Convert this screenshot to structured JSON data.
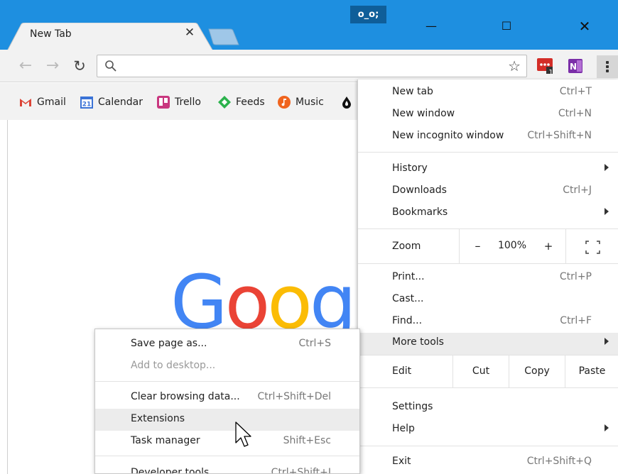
{
  "window": {
    "tab_title": "New Tab",
    "tab_close": "✕",
    "badge": "o_o;",
    "minimize": "—",
    "maximize": "☐",
    "close": "✕"
  },
  "toolbar": {
    "back": "←",
    "forward": "→",
    "reload": "↻",
    "star": "☆",
    "lastpass_count": "1"
  },
  "bookmarks": [
    {
      "label": "Gmail",
      "icon": "gmail-icon"
    },
    {
      "label": "Calendar",
      "icon": "calendar-icon",
      "badge": "21"
    },
    {
      "label": "Trello",
      "icon": "trello-icon"
    },
    {
      "label": "Feeds",
      "icon": "feedly-icon"
    },
    {
      "label": "Music",
      "icon": "music-icon"
    }
  ],
  "google_logo": {
    "letters": [
      "G",
      "o",
      "o",
      "g"
    ],
    "colors": [
      "#4285f4",
      "#ea4335",
      "#fbbc05",
      "#4285f4"
    ]
  },
  "menu": {
    "new_tab": {
      "label": "New tab",
      "shortcut": "Ctrl+T"
    },
    "new_window": {
      "label": "New window",
      "shortcut": "Ctrl+N"
    },
    "new_incognito": {
      "label": "New incognito window",
      "shortcut": "Ctrl+Shift+N"
    },
    "history": {
      "label": "History"
    },
    "downloads": {
      "label": "Downloads",
      "shortcut": "Ctrl+J"
    },
    "bookmarks": {
      "label": "Bookmarks"
    },
    "zoom": {
      "label": "Zoom",
      "minus": "–",
      "value": "100%",
      "plus": "+"
    },
    "print": {
      "label": "Print...",
      "shortcut": "Ctrl+P"
    },
    "cast": {
      "label": "Cast..."
    },
    "find": {
      "label": "Find...",
      "shortcut": "Ctrl+F"
    },
    "more_tools": {
      "label": "More tools"
    },
    "edit": {
      "label": "Edit",
      "cut": "Cut",
      "copy": "Copy",
      "paste": "Paste"
    },
    "settings": {
      "label": "Settings"
    },
    "help": {
      "label": "Help"
    },
    "exit": {
      "label": "Exit",
      "shortcut": "Ctrl+Shift+Q"
    }
  },
  "submenu": {
    "save_page": {
      "label": "Save page as...",
      "shortcut": "Ctrl+S"
    },
    "add_desktop": {
      "label": "Add to desktop..."
    },
    "clear_data": {
      "label": "Clear browsing data...",
      "shortcut": "Ctrl+Shift+Del"
    },
    "extensions": {
      "label": "Extensions"
    },
    "task_manager": {
      "label": "Task manager",
      "shortcut": "Shift+Esc"
    },
    "dev_tools": {
      "label": "Developer tools",
      "shortcut": "Ctrl+Shift+I"
    }
  },
  "colors": {
    "titlebar": "#1e8fe0",
    "toolbar": "#f2f2f2",
    "highlight": "#ececec"
  }
}
